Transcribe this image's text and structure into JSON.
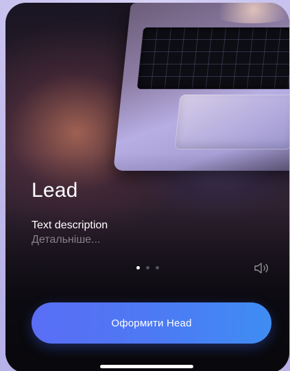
{
  "story": {
    "title": "Lead",
    "description": "Text description",
    "more_label": "Детальніше..."
  },
  "pagination": {
    "count": 3,
    "active_index": 0
  },
  "icons": {
    "sound": "volume-icon"
  },
  "cta": {
    "label": "Оформити Head"
  },
  "colors": {
    "cta_start": "#5a6ef5",
    "cta_end": "#3f8df3",
    "background": "#09080c",
    "text_primary": "#ffffff",
    "text_muted": "#b9b2c8"
  }
}
